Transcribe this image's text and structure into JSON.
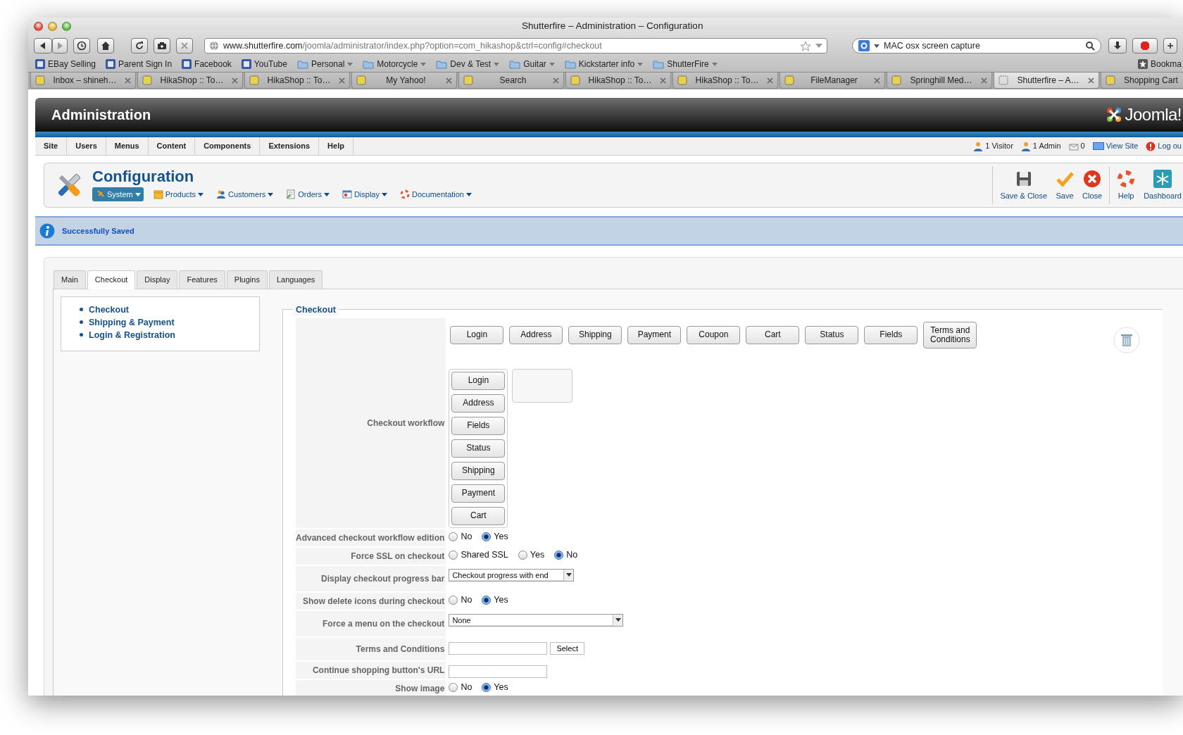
{
  "browser": {
    "title": "Shutterfire – Administration – Configuration",
    "url": {
      "host": "www.shutterfire.com",
      "path": "/joomla/administrator/index.php?option=com_hikashop&ctrl=config#checkout"
    },
    "search": {
      "value": "MAC osx screen capture"
    },
    "bookmarks": [
      {
        "label": "EBay Selling",
        "kind": "link"
      },
      {
        "label": "Parent Sign In",
        "kind": "link"
      },
      {
        "label": "Facebook",
        "kind": "link"
      },
      {
        "label": "YouTube",
        "kind": "link"
      },
      {
        "label": "Personal",
        "kind": "folder"
      },
      {
        "label": "Motorcycle",
        "kind": "folder"
      },
      {
        "label": "Dev & Test",
        "kind": "folder"
      },
      {
        "label": "Guitar",
        "kind": "folder"
      },
      {
        "label": "Kickstarter info",
        "kind": "folder"
      },
      {
        "label": "ShutterFire",
        "kind": "folder"
      }
    ],
    "bookmarks_menu": "Bookma",
    "tabs": [
      {
        "title": "Inbox – shineh…",
        "selected": false
      },
      {
        "title": "HikaShop :: To…",
        "selected": false
      },
      {
        "title": "HikaShop :: To…",
        "selected": false
      },
      {
        "title": "My Yahoo!",
        "selected": false
      },
      {
        "title": "Search",
        "selected": false
      },
      {
        "title": "HikaShop :: To…",
        "selected": false
      },
      {
        "title": "HikaShop :: To…",
        "selected": false
      },
      {
        "title": "FileManager",
        "selected": false
      },
      {
        "title": "Springhill Med…",
        "selected": false
      },
      {
        "title": "Shutterfire – A…",
        "selected": true
      },
      {
        "title": "Shopping Cart",
        "selected": false
      }
    ]
  },
  "admin": {
    "header_title": "Administration",
    "logo": "Joomla!",
    "menu": [
      "Site",
      "Users",
      "Menus",
      "Content",
      "Components",
      "Extensions",
      "Help"
    ],
    "status": [
      {
        "text": "1 Visitor",
        "kind": "visitors"
      },
      {
        "text": "1 Admin",
        "kind": "admins"
      },
      {
        "text": "0",
        "kind": "messages"
      },
      {
        "text": "View Site",
        "kind": "view_site"
      },
      {
        "text": "Log ou",
        "kind": "logout"
      }
    ],
    "toolbar": {
      "title": "Configuration",
      "submenu": [
        {
          "label": "System",
          "kind": "system",
          "selected": true
        },
        {
          "label": "Products",
          "kind": "products",
          "selected": false
        },
        {
          "label": "Customers",
          "kind": "customers",
          "selected": false
        },
        {
          "label": "Orders",
          "kind": "orders",
          "selected": false
        },
        {
          "label": "Display",
          "kind": "display",
          "selected": false
        },
        {
          "label": "Documentation",
          "kind": "documentation",
          "selected": false
        }
      ],
      "buttons": [
        {
          "label": "Save & Close",
          "kind": "save_close"
        },
        {
          "label": "Save",
          "kind": "save"
        },
        {
          "label": "Close",
          "kind": "close"
        },
        {
          "label": "Help",
          "kind": "help"
        },
        {
          "label": "Dashboard",
          "kind": "dashboard"
        }
      ]
    },
    "message": "Successfully Saved",
    "config_tabs": [
      {
        "label": "Main",
        "selected": false
      },
      {
        "label": "Checkout",
        "selected": true
      },
      {
        "label": "Display",
        "selected": false
      },
      {
        "label": "Features",
        "selected": false
      },
      {
        "label": "Plugins",
        "selected": false
      },
      {
        "label": "Languages",
        "selected": false
      }
    ],
    "side_nav": [
      "Checkout",
      "Shipping & Payment",
      "Login & Registration"
    ],
    "fieldset": {
      "legend": "Checkout",
      "workflow": {
        "label": "Checkout workflow",
        "available": [
          "Login",
          "Address",
          "Shipping",
          "Payment",
          "Coupon",
          "Cart",
          "Status",
          "Fields",
          "Terms and Conditions"
        ],
        "steps": [
          "Login",
          "Address",
          "Fields",
          "Status",
          "Shipping",
          "Payment",
          "Cart"
        ]
      },
      "settings": [
        {
          "label": "Advanced checkout workflow edition",
          "kind": "radio",
          "options": [
            {
              "label": "No",
              "selected": false
            },
            {
              "label": "Yes",
              "selected": true
            }
          ]
        },
        {
          "label": "Force SSL on checkout",
          "kind": "radio",
          "options": [
            {
              "label": "Shared SSL",
              "selected": false
            },
            {
              "label": "Yes",
              "selected": false
            },
            {
              "label": "No",
              "selected": true
            }
          ]
        },
        {
          "label": "Display checkout progress bar",
          "kind": "select",
          "value": "Checkout progress with end"
        },
        {
          "label": "Show delete icons during checkout",
          "kind": "radio",
          "options": [
            {
              "label": "No",
              "selected": false
            },
            {
              "label": "Yes",
              "selected": true
            }
          ]
        },
        {
          "label": "Force a menu on the checkout",
          "kind": "select",
          "value": "None"
        },
        {
          "label": "Terms and Conditions",
          "kind": "text_button",
          "button": "Select"
        },
        {
          "label": "Continue shopping button's URL",
          "kind": "text"
        },
        {
          "label": "Show image",
          "kind": "radio",
          "options": [
            {
              "label": "No",
              "selected": false
            },
            {
              "label": "Yes",
              "selected": true
            }
          ]
        }
      ]
    }
  }
}
